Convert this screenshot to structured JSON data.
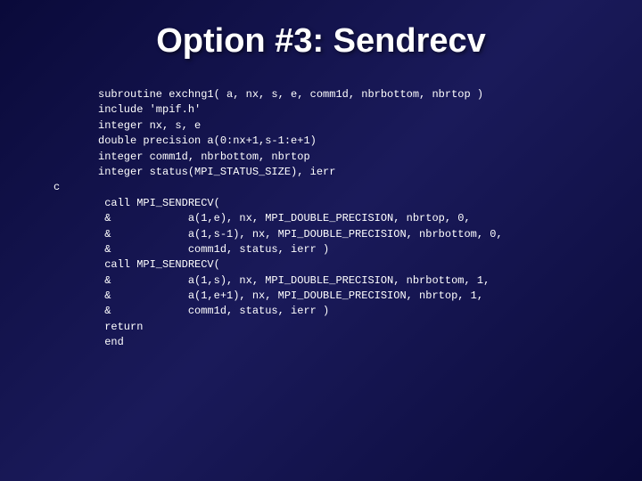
{
  "title": "Option #3: Sendrecv",
  "code": {
    "line1": "subroutine exchng1( a, nx, s, e, comm1d, nbrbottom, nbrtop )",
    "line2": "include 'mpif.h'",
    "line3": "integer nx, s, e",
    "line4": "double precision a(0:nx+1,s-1:e+1)",
    "line5": "integer comm1d, nbrbottom, nbrtop",
    "line6": "integer status(MPI_STATUS_SIZE), ierr",
    "comment": "c",
    "line7": " call MPI_SENDRECV(",
    "line8": " &            a(1,e), nx, MPI_DOUBLE_PRECISION, nbrtop, 0,",
    "line9": " &            a(1,s-1), nx, MPI_DOUBLE_PRECISION, nbrbottom, 0,",
    "line10": " &            comm1d, status, ierr )",
    "line11": " call MPI_SENDRECV(",
    "line12": " &            a(1,s), nx, MPI_DOUBLE_PRECISION, nbrbottom, 1,",
    "line13": " &            a(1,e+1), nx, MPI_DOUBLE_PRECISION, nbrtop, 1,",
    "line14": " &            comm1d, status, ierr )",
    "line15": " return",
    "line16": " end"
  }
}
